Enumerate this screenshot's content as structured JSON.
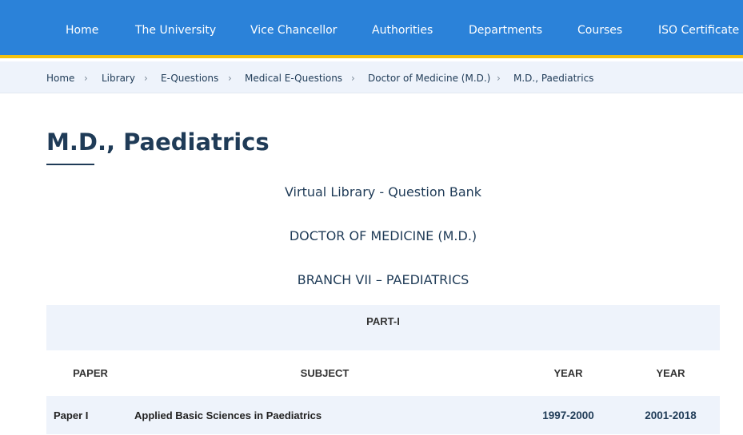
{
  "nav": {
    "items": [
      "Home",
      "The University",
      "Vice Chancellor",
      "Authorities",
      "Departments",
      "Courses",
      "ISO Certificate"
    ]
  },
  "breadcrumb": {
    "items": [
      "Home",
      "Library",
      "E-Questions",
      "Medical E-Questions",
      "Doctor of Medicine (M.D.)",
      "M.D., Paediatrics"
    ],
    "separator": "›"
  },
  "page": {
    "title": "M.D., Paediatrics",
    "heading1": "Virtual Library - Question Bank",
    "heading2": "DOCTOR OF MEDICINE (M.D.)",
    "heading3": "BRANCH VII – PAEDIATRICS"
  },
  "table": {
    "part_label": "PART-I",
    "headers": [
      "PAPER",
      "SUBJECT",
      "YEAR",
      "YEAR"
    ],
    "rows": [
      [
        "Paper I",
        "Applied Basic Sciences in Paediatrics",
        "1997-2000",
        "2001-2018"
      ]
    ]
  },
  "colors": {
    "nav_bg": "#2b82d9",
    "nav_border": "#f2c10f",
    "breadcrumb_bg": "#eef3fb",
    "text_dark": "#1f3b57"
  }
}
